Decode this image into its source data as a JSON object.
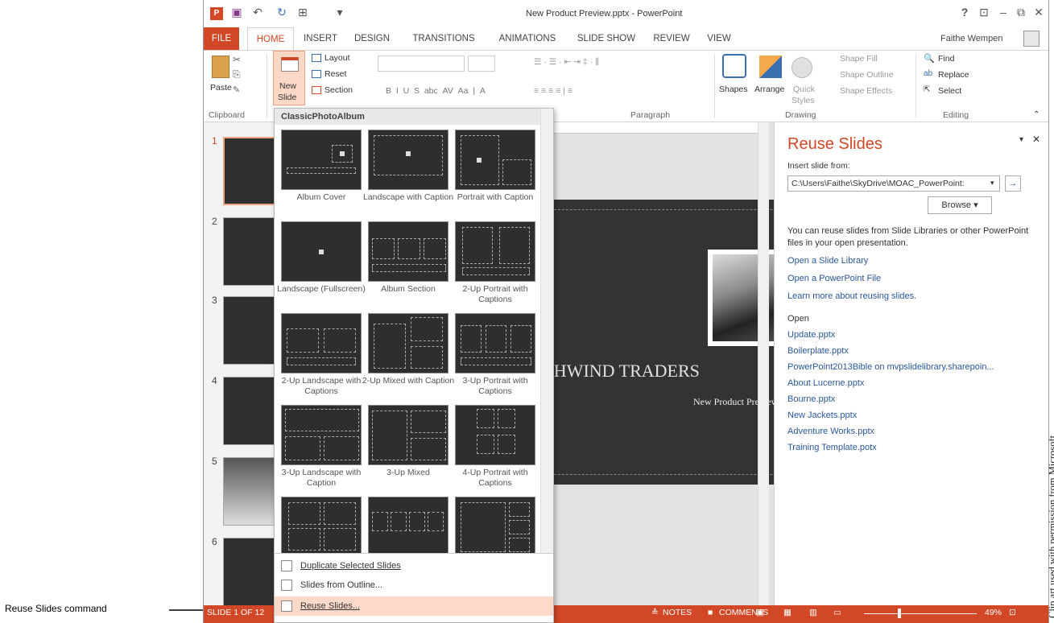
{
  "window_title": "New Product Preview.pptx - PowerPoint",
  "user_name": "Faithe Wempen",
  "tabs": [
    "FILE",
    "HOME",
    "INSERT",
    "DESIGN",
    "TRANSITIONS",
    "ANIMATIONS",
    "SLIDE SHOW",
    "REVIEW",
    "VIEW"
  ],
  "ribbon": {
    "paste": "Paste",
    "new_slide_top": "New",
    "new_slide_bottom": "Slide",
    "layout": "Layout",
    "reset": "Reset",
    "section": "Section",
    "shapes": "Shapes",
    "arrange": "Arrange",
    "quick_top": "Quick",
    "quick_bottom": "Styles",
    "shape_fill": "Shape Fill",
    "shape_outline": "Shape Outline",
    "shape_effects": "Shape Effects",
    "find": "Find",
    "replace": "Replace",
    "select": "Select",
    "groups": {
      "clipboard": "Clipboard",
      "paragraph": "Paragraph",
      "drawing": "Drawing",
      "editing": "Editing"
    }
  },
  "gallery": {
    "header": "ClassicPhotoAlbum",
    "layouts": [
      {
        "name": "Album Cover"
      },
      {
        "name": "Landscape with Caption"
      },
      {
        "name": "Portrait with Caption"
      },
      {
        "name": "Landscape (Fullscreen)"
      },
      {
        "name": "Album Section"
      },
      {
        "name": "2-Up Portrait with Captions"
      },
      {
        "name": "2-Up Landscape with Captions"
      },
      {
        "name": "2-Up Mixed with Caption"
      },
      {
        "name": "3-Up Portrait with Captions"
      },
      {
        "name": "3-Up Landscape with Caption"
      },
      {
        "name": "3-Up Mixed"
      },
      {
        "name": "4-Up Portrait with Captions"
      }
    ],
    "menu": [
      "Duplicate Selected Slides",
      "Slides from Outline...",
      "Reuse Slides..."
    ]
  },
  "slide_numbers": [
    "1",
    "2",
    "3",
    "4",
    "5",
    "6"
  ],
  "slide": {
    "title": "RTHWIND TRADERS",
    "subtitle": "New Product Preview"
  },
  "pane": {
    "title": "Reuse Slides",
    "insert_label": "Insert slide from:",
    "path": "C:\\Users\\Faithe\\SkyDrive\\MOAC_PowerPoint:",
    "browse": "Browse",
    "info": "You can reuse slides from Slide Libraries or other PowerPoint files in your open presentation.",
    "links": [
      "Open a Slide Library",
      "Open a PowerPoint File",
      "Learn more about reusing slides."
    ],
    "open_label": "Open",
    "files": [
      "Update.pptx",
      "Boilerplate.pptx",
      "PowerPoint2013Bible on mvpslidelibrary.sharepoin...",
      "About Lucerne.pptx",
      "Bourne.pptx",
      "New Jackets.pptx",
      "Adventure Works.pptx",
      "Training Template.potx"
    ]
  },
  "status": {
    "slide": "SLIDE 1 OF 12",
    "notes": "NOTES",
    "comments": "COMMENTS",
    "zoom": "49%"
  },
  "callout": "Reuse Slides command",
  "credit": "Clip art used with permission from Microsoft",
  "colors": {
    "accent": "#d24726",
    "link": "#2b579a"
  }
}
